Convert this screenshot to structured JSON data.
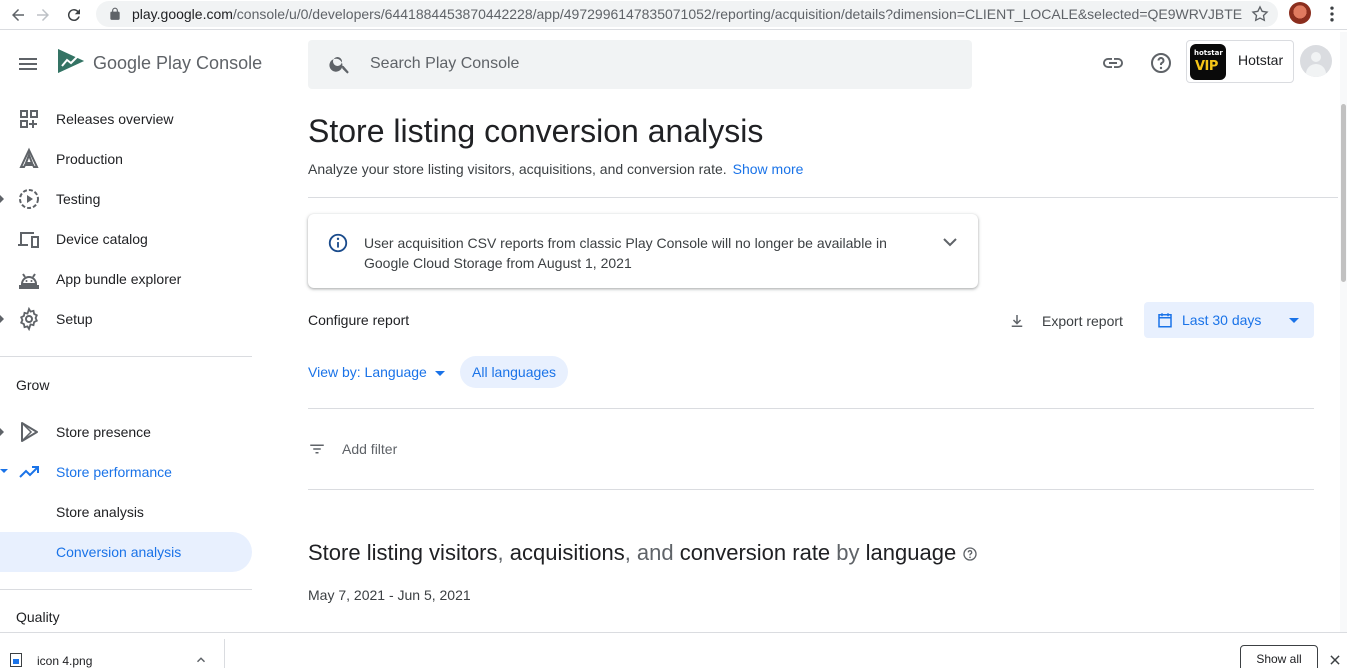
{
  "browser": {
    "url_host": "play.google.com",
    "url_rest": "/console/u/0/developers/6441884453870442228/app/4972996147835071052/reporting/acquisition/details?dimension=CLIENT_LOCALE&selected=QE9WRVJBTE..."
  },
  "header": {
    "logo_text": "Google Play Console",
    "search_placeholder": "Search Play Console",
    "app_name": "Hotstar",
    "app_icon_top": "hotstar",
    "app_icon_bottom": "VIP"
  },
  "sidebar": {
    "items": [
      {
        "label": "Releases overview",
        "icon": "releases-icon"
      },
      {
        "label": "Production",
        "icon": "production-icon"
      },
      {
        "label": "Testing",
        "icon": "testing-icon"
      },
      {
        "label": "Device catalog",
        "icon": "device-icon"
      },
      {
        "label": "App bundle explorer",
        "icon": "android-icon"
      },
      {
        "label": "Setup",
        "icon": "gear-icon"
      }
    ],
    "grow_heading": "Grow",
    "grow_items": [
      {
        "label": "Store presence",
        "icon": "play-icon"
      },
      {
        "label": "Store performance",
        "icon": "trending-icon"
      },
      {
        "label": "Store analysis"
      },
      {
        "label": "Conversion analysis"
      }
    ],
    "quality_heading": "Quality"
  },
  "main": {
    "title": "Store listing conversion analysis",
    "subtitle": "Analyze your store listing visitors, acquisitions, and conversion rate.",
    "show_more": "Show more",
    "banner": "User acquisition CSV reports from classic Play Console will no longer be available in Google Cloud Storage from August 1, 2021",
    "configure_report": "Configure report",
    "export_report": "Export report",
    "date_range_button": "Last 30 days",
    "view_by": "View by: Language",
    "chip": "All languages",
    "add_filter": "Add filter",
    "chart_title": {
      "p1": "Store listing visitors",
      "p2": ", ",
      "p3": "acquisitions",
      "p4": ", and ",
      "p5": "conversion rate",
      "p6": " by ",
      "p7": "language"
    },
    "date_range": "May 7, 2021 - Jun 5, 2021"
  },
  "downloads": {
    "file_name": "icon 4.png",
    "show_all": "Show all"
  },
  "colors": {
    "accent": "#1a73e8",
    "selected_bg": "#e8f0fe"
  }
}
